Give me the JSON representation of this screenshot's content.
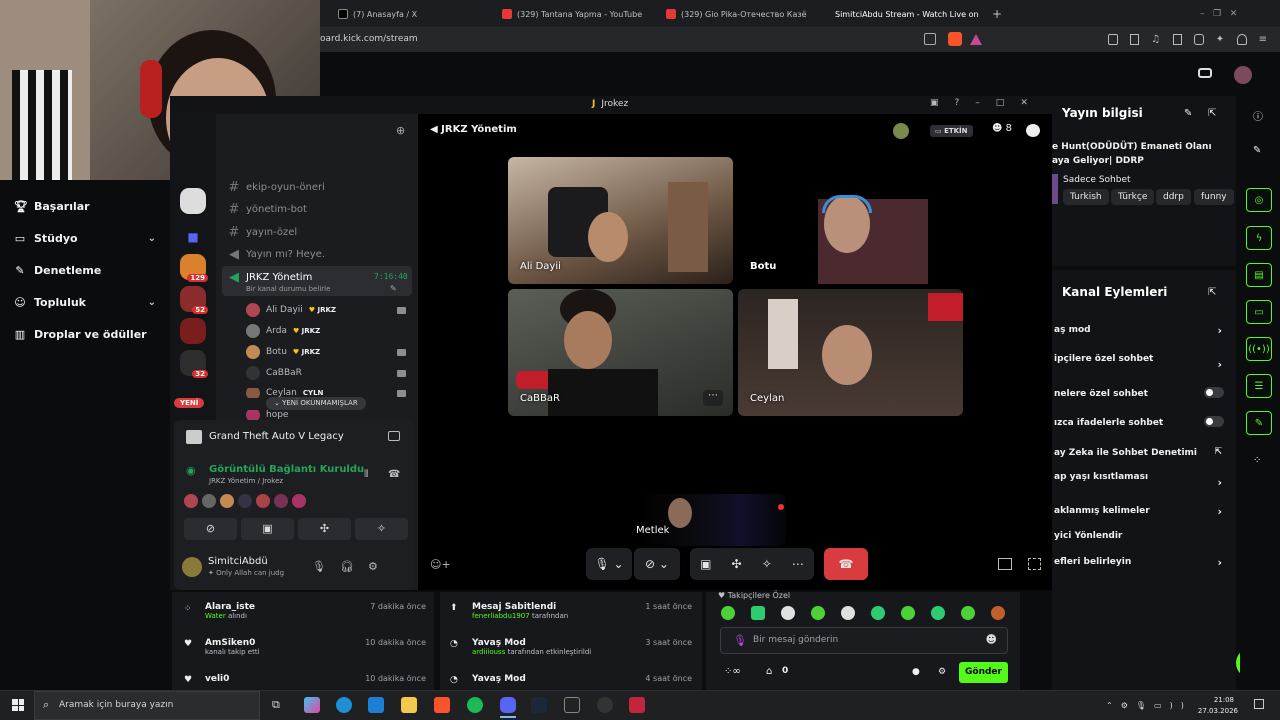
{
  "browser": {
    "tabs": [
      {
        "label": "(7) Anasayfa / X"
      },
      {
        "label": "(329) Tantana Yapma - YouTube"
      },
      {
        "label": "(329) Gio Pika-Отечество Казё"
      },
      {
        "label": "SimitciAbdu Stream - Watch Live on"
      }
    ],
    "url": "oard.kick.com/stream"
  },
  "left_nav": {
    "items": [
      {
        "label": "Başarılar"
      },
      {
        "label": "Stüdyo"
      },
      {
        "label": "Denetleme"
      },
      {
        "label": "Topluluk"
      },
      {
        "label": "Droplar ve ödüller"
      }
    ]
  },
  "discord": {
    "window_title": "Jrokez",
    "voice_channel_header": "JRKZ Yönetim",
    "live_badge": "ETKİN",
    "member_count": "8",
    "channels": [
      {
        "name": "ekip-oyun-öneri"
      },
      {
        "name": "yönetim-bot"
      },
      {
        "name": "yayın-özel"
      },
      {
        "name": "Yayın mı? Heye."
      },
      {
        "name": "JRKZ Yönetim",
        "time": "7:16:40",
        "status": "Bir kanal durumu belirle"
      }
    ],
    "members": [
      {
        "name": "Ali Dayii",
        "tag": "JRKZ"
      },
      {
        "name": "Arda",
        "tag": "JRKZ"
      },
      {
        "name": "Botu",
        "tag": "JRKZ"
      },
      {
        "name": "CaBBaR",
        "tag": ""
      },
      {
        "name": "Ceylan",
        "tag": "CYLN"
      },
      {
        "name": "hope",
        "tag": ""
      }
    ],
    "guild_badges": [
      "129",
      "52",
      "32"
    ],
    "new_label": "YENİ",
    "unread_label": "YENİ OKUNMAMIŞLAR",
    "activity": "Grand Theft Auto V Legacy",
    "connection_status": "Görüntülü Bağlantı Kuruldu",
    "connection_sub": "JRKZ Yönetim / Jrokez",
    "user": {
      "name": "SimitciAbdü",
      "status": "Only Allah can judg"
    },
    "tiles": [
      {
        "name": "Ali Dayii"
      },
      {
        "name": "Botu"
      },
      {
        "name": "CaBBaR"
      },
      {
        "name": "Ceylan"
      },
      {
        "name": "Metlek"
      }
    ]
  },
  "stream_info": {
    "title": "Yayın bilgisi",
    "stream_title_line1": "e Hunt(ODÜDÜT) Emaneti Olanı",
    "stream_title_line2": "aya Geliyor| DDRP",
    "category": "Sadece Sohbet",
    "tags": [
      "Turkish",
      "Türkçe",
      "ddrp",
      "funny"
    ]
  },
  "channel_actions": {
    "title": "Kanal Eylemleri",
    "items": [
      {
        "label": "aş mod",
        "control": "arrow"
      },
      {
        "label": "ipçilere özel sohbet",
        "control": "arrow"
      },
      {
        "label": "nelere özel sohbet",
        "control": "toggle"
      },
      {
        "label": "ızca ifadelerle sohbet",
        "control": "toggle"
      },
      {
        "label": "ay Zeka ile Sohbet Denetimi",
        "control": "external"
      },
      {
        "label": "ap yaşı kısıtlaması",
        "control": "arrow"
      },
      {
        "label": "aklanmış kelimeler",
        "control": "arrow"
      },
      {
        "label": "yici Yönlendir",
        "control": "none"
      },
      {
        "label": "efleri belirleyin",
        "control": "arrow"
      }
    ]
  },
  "feed": [
    {
      "title": "Alara_iste",
      "sub_hl": "Water",
      "sub": "alındı",
      "time": "7 dakika önce"
    },
    {
      "title": "AmSiken0",
      "sub_hl": "",
      "sub": "kanalı takip etti",
      "time": "10 dakika önce"
    },
    {
      "title": "veli0",
      "sub_hl": "",
      "sub": "",
      "time": "10 dakika önce"
    }
  ],
  "mod_log": [
    {
      "title": "Mesaj Sabitlendi",
      "sub_hl": "fenerliabdu1907",
      "sub": "tarafından",
      "time": "1 saat önce"
    },
    {
      "title": "Yavaş Mod",
      "sub_hl": "ardiiiouss",
      "sub": "tarafından etkinleştirildi",
      "time": "3 saat önce"
    },
    {
      "title": "Yavaş Mod",
      "sub_hl": "",
      "sub": "",
      "time": "4 saat önce"
    }
  ],
  "chat": {
    "mode_label": "Takipçilere Özel",
    "placeholder": "Bir mesaj gönderin",
    "points": "0",
    "send_label": "Gönder"
  },
  "taskbar": {
    "search_placeholder": "Aramak için buraya yazın",
    "time": "21:08",
    "date": "27.03.2026"
  },
  "colors": {
    "accent": "#53fc18",
    "discord_green": "#23a55a",
    "danger": "#d83c3e"
  }
}
